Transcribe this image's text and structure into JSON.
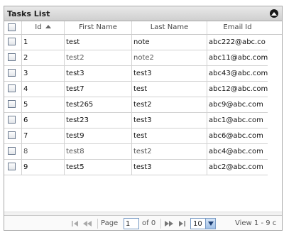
{
  "caption": {
    "title": "Tasks List",
    "collapse_icon": "collapse-up-icon"
  },
  "columns": [
    {
      "key": "select",
      "label": ""
    },
    {
      "key": "id",
      "label": "Id",
      "sort_icon": "sort-ascending-icon"
    },
    {
      "key": "first_name",
      "label": "First Name"
    },
    {
      "key": "last_name",
      "label": "Last Name"
    },
    {
      "key": "email",
      "label": "Email Id"
    }
  ],
  "rows": [
    {
      "id": "1",
      "first_name": "test",
      "last_name": "note",
      "email": "abc222@abc.co"
    },
    {
      "id": "2",
      "first_name": "test2",
      "last_name": "note2",
      "email": "abc11@abc.com"
    },
    {
      "id": "3",
      "first_name": "test3",
      "last_name": "test3",
      "email": "abc43@abc.com"
    },
    {
      "id": "4",
      "first_name": "test7",
      "last_name": "test",
      "email": "abc12@abc.com"
    },
    {
      "id": "5",
      "first_name": "test265",
      "last_name": "test2",
      "email": "abc9@abc.com"
    },
    {
      "id": "6",
      "first_name": "test23",
      "last_name": "test3",
      "email": "abc1@abc.com"
    },
    {
      "id": "7",
      "first_name": "test9",
      "last_name": "test",
      "email": "abc6@abc.com"
    },
    {
      "id": "8",
      "first_name": "test8",
      "last_name": "test2",
      "email": "abc4@abc.com"
    },
    {
      "id": "9",
      "first_name": "test5",
      "last_name": "test3",
      "email": "abc2@abc.com"
    }
  ],
  "pager": {
    "page_label": "Page",
    "page_value": "1",
    "of_label": "of 0",
    "rows_per_page": "10",
    "view_text": "View 1 - 9 c",
    "icons": [
      "first-page-icon",
      "prev-page-icon",
      "next-page-icon",
      "last-page-icon",
      "dropdown-arrow-icon"
    ]
  }
}
